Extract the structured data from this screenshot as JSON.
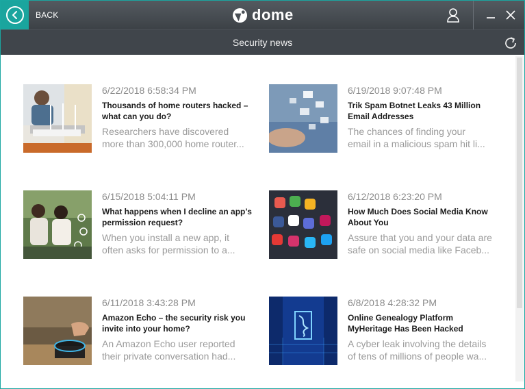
{
  "header": {
    "back_label": "BACK",
    "logo_text": "dome",
    "accent_color": "#1aa59e"
  },
  "subheader": {
    "title": "Security news"
  },
  "icons": {
    "back": "chevron-left-circle-icon",
    "user": "user-icon",
    "minimize": "minimize-icon",
    "close": "close-icon",
    "refresh": "refresh-icon"
  },
  "articles": [
    {
      "date": "6/22/2018 6:58:34 PM",
      "title": "Thousands of home routers hacked – what can you do?",
      "snippet_line1": "Researchers have discovered",
      "snippet_line2": "more than 300,000 home router..."
    },
    {
      "date": "6/19/2018 9:07:48 PM",
      "title": "Trik Spam Botnet Leaks 43 Million Email Addresses",
      "snippet_line1": "The chances of finding your",
      "snippet_line2": "email in a malicious spam hit li..."
    },
    {
      "date": "6/15/2018 5:04:11 PM",
      "title": "What happens when I decline an app’s permission request?",
      "snippet_line1": "When you install a new app, it",
      "snippet_line2": "often asks for permission to a..."
    },
    {
      "date": "6/12/2018 6:23:20 PM",
      "title": "How Much Does Social Media Know About You",
      "snippet_line1": "Assure that you and your data are",
      "snippet_line2": "safe on social media like Faceb..."
    },
    {
      "date": "6/11/2018 3:43:28 PM",
      "title": "Amazon Echo – the security risk you invite into your home?",
      "snippet_line1": "An Amazon Echo user reported",
      "snippet_line2": "their private conversation had..."
    },
    {
      "date": "6/8/2018 4:28:32 PM",
      "title": "Online Genealogy Platform MyHeritage Has Been Hacked",
      "snippet_line1": "A cyber leak involving the details",
      "snippet_line2": "of tens of millions of people wa..."
    }
  ]
}
